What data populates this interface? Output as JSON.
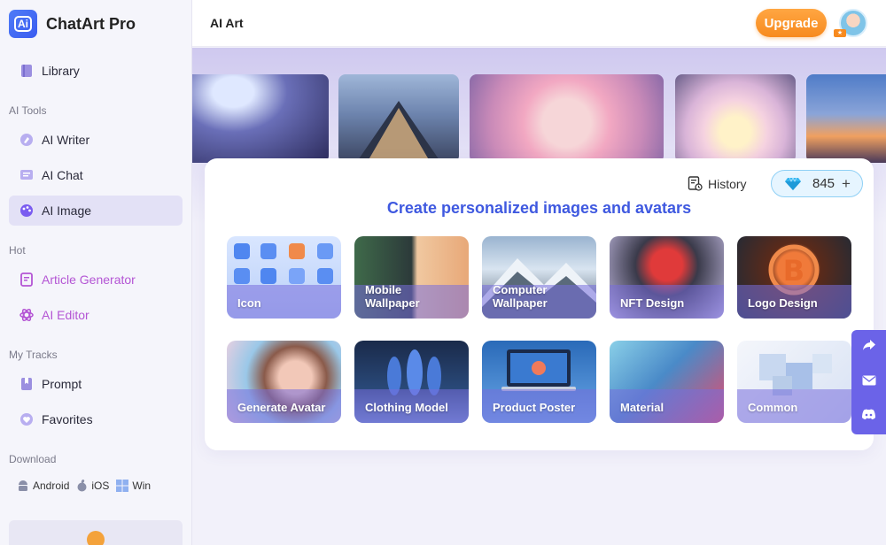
{
  "app": {
    "name": "ChatArt Pro",
    "logo_text": "Ai"
  },
  "sidebar": {
    "library": "Library",
    "sections": {
      "ai_tools": "AI Tools",
      "hot": "Hot",
      "my_tracks": "My Tracks",
      "download": "Download"
    },
    "ai_tools": [
      {
        "label": "AI Writer",
        "icon": "writer-icon"
      },
      {
        "label": "AI Chat",
        "icon": "chat-icon"
      },
      {
        "label": "AI Image",
        "icon": "palette-icon",
        "active": true
      }
    ],
    "hot": [
      {
        "label": "Article Generator",
        "icon": "article-icon"
      },
      {
        "label": "AI Editor",
        "icon": "atom-icon"
      }
    ],
    "tracks": [
      {
        "label": "Prompt",
        "icon": "bookmark-icon"
      },
      {
        "label": "Favorites",
        "icon": "heart-icon"
      }
    ],
    "downloads": [
      {
        "label": "Android",
        "icon": "android-icon"
      },
      {
        "label": "iOS",
        "icon": "apple-icon"
      },
      {
        "label": "Win",
        "icon": "windows-icon"
      }
    ]
  },
  "header": {
    "title": "AI Art",
    "upgrade": "Upgrade"
  },
  "panel": {
    "history": "History",
    "credits": "845",
    "credits_plus": "+",
    "title": "Create personalized images and avatars"
  },
  "categories": [
    {
      "label": "Icon"
    },
    {
      "label": "Mobile Wallpaper"
    },
    {
      "label": "Computer Wallpaper"
    },
    {
      "label": "NFT Design"
    },
    {
      "label": "Logo Design"
    },
    {
      "label": "Generate Avatar"
    },
    {
      "label": "Clothing Model"
    },
    {
      "label": "Product Poster"
    },
    {
      "label": "Material"
    },
    {
      "label": "Common"
    }
  ],
  "colors": {
    "accent": "#3f59e0",
    "upgrade": "#f78a1e",
    "float_bar": "#6b63e8",
    "hot_text": "#b455d4"
  }
}
